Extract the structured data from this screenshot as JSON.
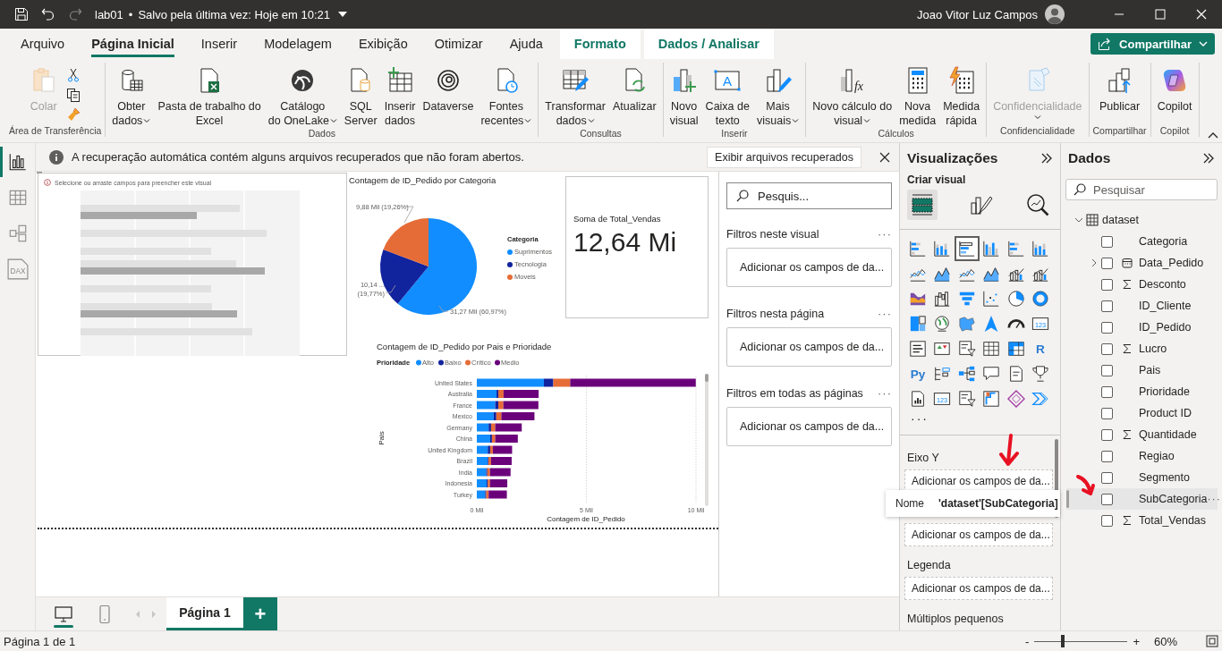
{
  "title_bar": {
    "file_name": "lab01",
    "separator": "•",
    "save_status": "Salvo pela última vez: Hoje em 10:21",
    "user_name": "Joao Vitor Luz Campos"
  },
  "ribbon_tabs": [
    {
      "label": "Arquivo",
      "selected": false,
      "kind": "normal"
    },
    {
      "label": "Página Inicial",
      "selected": true,
      "kind": "normal"
    },
    {
      "label": "Inserir",
      "selected": false,
      "kind": "normal"
    },
    {
      "label": "Modelagem",
      "selected": false,
      "kind": "normal"
    },
    {
      "label": "Exibição",
      "selected": false,
      "kind": "normal"
    },
    {
      "label": "Otimizar",
      "selected": false,
      "kind": "normal"
    },
    {
      "label": "Ajuda",
      "selected": false,
      "kind": "normal"
    },
    {
      "label": "Formato",
      "selected": false,
      "kind": "contextual"
    },
    {
      "label": "Dados / Analisar",
      "selected": false,
      "kind": "contextual"
    }
  ],
  "share_button": {
    "label": "Compartilhar"
  },
  "ribbon_groups": [
    {
      "label": "Área de Transferência",
      "kind": "clipboard",
      "buttons": [
        {
          "lines": [
            "Colar"
          ],
          "dropdown": false,
          "disabled": true
        }
      ]
    },
    {
      "label": "Dados",
      "kind": "standard",
      "buttons": [
        {
          "lines": [
            "Obter",
            "dados"
          ],
          "dropdown": true,
          "disabled": false
        },
        {
          "lines": [
            "Pasta de trabalho do",
            "Excel"
          ],
          "dropdown": false,
          "disabled": false
        },
        {
          "lines": [
            "Catálogo",
            "do OneLake"
          ],
          "dropdown": true,
          "disabled": false
        },
        {
          "lines": [
            "SQL",
            "Server"
          ],
          "dropdown": false,
          "disabled": false
        },
        {
          "lines": [
            "Inserir",
            "dados"
          ],
          "dropdown": false,
          "disabled": false
        },
        {
          "lines": [
            "Dataverse"
          ],
          "dropdown": false,
          "disabled": false
        },
        {
          "lines": [
            "Fontes",
            "recentes"
          ],
          "dropdown": true,
          "disabled": false
        }
      ]
    },
    {
      "label": "Consultas",
      "kind": "standard",
      "buttons": [
        {
          "lines": [
            "Transformar",
            "dados"
          ],
          "dropdown": true,
          "disabled": false
        },
        {
          "lines": [
            "Atualizar"
          ],
          "dropdown": false,
          "disabled": false
        }
      ]
    },
    {
      "label": "Inserir",
      "kind": "standard",
      "buttons": [
        {
          "lines": [
            "Novo",
            "visual"
          ],
          "dropdown": false,
          "disabled": false
        },
        {
          "lines": [
            "Caixa de",
            "texto"
          ],
          "glyph": "A",
          "dropdown": false,
          "disabled": false
        },
        {
          "lines": [
            "Mais",
            "visuais"
          ],
          "dropdown": true,
          "disabled": false
        }
      ]
    },
    {
      "label": "Cálculos",
      "kind": "standard",
      "buttons": [
        {
          "lines": [
            "Novo cálculo do",
            "visual"
          ],
          "dropdown": true,
          "glyph": "fx",
          "disabled": false
        },
        {
          "lines": [
            "Nova",
            "medida"
          ],
          "dropdown": false,
          "disabled": false
        },
        {
          "lines": [
            "Medida",
            "rápida"
          ],
          "dropdown": false,
          "disabled": false
        }
      ]
    },
    {
      "label": "Confidencialidade",
      "kind": "standard",
      "buttons": [
        {
          "lines": [
            "Confidencialidade"
          ],
          "dropdown": true,
          "disabled": true
        }
      ]
    },
    {
      "label": "Compartilhar",
      "kind": "standard",
      "buttons": [
        {
          "lines": [
            "Publicar"
          ],
          "dropdown": false,
          "disabled": false
        }
      ]
    },
    {
      "label": "Copilot",
      "kind": "standard",
      "buttons": [
        {
          "lines": [
            "Copilot"
          ],
          "dropdown": false,
          "disabled": false
        }
      ]
    }
  ],
  "left_nav": [
    {
      "selected": true
    },
    {
      "selected": false
    },
    {
      "selected": false
    },
    {
      "selected": false,
      "glyph": "DAX"
    }
  ],
  "recovery_bar": {
    "message": "A recuperação automática contém alguns arquivos recuperados que não foram abertos.",
    "button": "Exibir arquivos recuperados"
  },
  "report": {
    "placeholder_visual": {
      "hint": "Selecione ou arraste campos para preencher este visual"
    },
    "pie_visual": {
      "title": "Contagem de ID_Pedido por Categoria",
      "legend_title": "Categoria",
      "legend": [
        {
          "color": "#118dff"
        },
        {
          "color": "#12239e"
        },
        {
          "color": "#e66c37"
        }
      ],
      "chart_data": {
        "type": "pie",
        "legend": "right",
        "categories": [
          "Suprimentos",
          "Tecnologia",
          "Moveis"
        ],
        "values": [
          31.27,
          10.14,
          9.88
        ],
        "value_labels": [
          "31,27 Mil (60,97%)",
          "10,14 ... (19,77%)",
          "9,88 Mil (19,26%)"
        ]
      }
    },
    "card_visual": {
      "label": "Soma de Total_Vendas",
      "value": "12,64 Mi"
    },
    "bar_visual": {
      "title": "Contagem de ID_Pedido por Pais e Prioridade",
      "legend_title": "Prioridade",
      "chart_data": {
        "type": "bar",
        "orientation": "horizontal",
        "stacked": true,
        "legend": "top",
        "xlabel": "Contagem de ID_Pedido",
        "ylabel": "Pais",
        "categories": [
          "United States",
          "Australia",
          "France",
          "Mexico",
          "Germany",
          "China",
          "United Kingdom",
          "Brazil",
          "India",
          "Indonesia",
          "Turkey"
        ],
        "series": [
          {
            "name": "Alto",
            "color": "#118dff",
            "values": [
              3.06,
              0.9,
              0.84,
              0.77,
              0.54,
              0.61,
              0.5,
              0.5,
              0.43,
              0.45,
              0.38
            ]
          },
          {
            "name": "Baixo",
            "color": "#12239e",
            "values": [
              0.43,
              0.08,
              0.14,
              0.12,
              0.11,
              0.08,
              0.11,
              0.03,
              0.05,
              0.05,
              0.05
            ]
          },
          {
            "name": "Crítico",
            "color": "#e66c37",
            "values": [
              0.77,
              0.24,
              0.23,
              0.23,
              0.19,
              0.15,
              0.12,
              0.12,
              0.12,
              0.1,
              0.11
            ]
          },
          {
            "name": "Medio",
            "color": "#6b007b",
            "values": [
              5.73,
              1.6,
              1.6,
              1.51,
              1.21,
              1.03,
              0.88,
              0.94,
              0.94,
              0.79,
              0.83
            ]
          }
        ],
        "xlim": [
          0,
          10
        ],
        "xticks": [
          {
            "value": 0,
            "label": "0 Mil"
          },
          {
            "value": 5,
            "label": "5 Mil"
          },
          {
            "value": 10,
            "label": "10 Mil"
          }
        ]
      }
    }
  },
  "filters": {
    "search_placeholder": "Pesquis...",
    "sections": [
      {
        "heading": "Filtros neste visual",
        "more": "···",
        "drop_hint": "Adicionar os campos de da..."
      },
      {
        "heading": "Filtros nesta página",
        "more": "···",
        "drop_hint": "Adicionar os campos de da..."
      },
      {
        "heading": "Filtros em todas as páginas",
        "more": "···",
        "drop_hint": "Adicionar os campos de da..."
      }
    ]
  },
  "visualizations": {
    "title": "Visualizações",
    "subtitle": "Criar visual",
    "modes": [
      {
        "selected": true
      },
      {
        "selected": false
      },
      {
        "selected": false
      }
    ],
    "visual_types": [
      {
        "selected": false
      },
      {
        "selected": false
      },
      {
        "selected": true
      },
      {
        "selected": false
      },
      {
        "selected": false
      },
      {
        "selected": false
      },
      {
        "selected": false
      },
      {
        "selected": false
      },
      {
        "selected": false
      },
      {
        "selected": false
      },
      {
        "selected": false
      },
      {
        "selected": false
      },
      {
        "selected": false
      },
      {
        "selected": false
      },
      {
        "selected": false
      },
      {
        "selected": false
      },
      {
        "selected": false
      },
      {
        "selected": false
      },
      {
        "selected": false
      },
      {
        "selected": false
      },
      {
        "selected": false
      },
      {
        "selected": false
      },
      {
        "selected": false
      },
      {
        "selected": false,
        "glyph": "123"
      },
      {
        "selected": false
      },
      {
        "selected": false
      },
      {
        "selected": false
      },
      {
        "selected": false
      },
      {
        "selected": false
      },
      {
        "selected": false,
        "glyph": "R"
      },
      {
        "selected": false,
        "glyph": "Py"
      },
      {
        "selected": false
      },
      {
        "selected": false
      },
      {
        "selected": false
      },
      {
        "selected": false
      },
      {
        "selected": false
      },
      {
        "selected": false
      },
      {
        "selected": false,
        "glyph": "123"
      },
      {
        "selected": false
      },
      {
        "selected": false
      },
      {
        "selected": false
      },
      {
        "selected": false
      }
    ],
    "more": "···",
    "wells": [
      {
        "label": "Eixo Y",
        "hint": "Adicionar os campos de da..."
      },
      {
        "hint": "Adicionar os campos de da..."
      },
      {
        "label": "Legenda",
        "hint": "Adicionar os campos de da..."
      },
      {
        "label": "Múltiplos pequenos"
      }
    ]
  },
  "tooltip": {
    "key": "Nome",
    "value": "'dataset'[SubCategoria]"
  },
  "data_pane": {
    "title": "Dados",
    "search_placeholder": "Pesquisar",
    "tables": [
      {
        "label": "dataset",
        "expanded": true,
        "fields": [
          {
            "label": "Categoria",
            "kind": "text",
            "checked": false,
            "highlighted": false
          },
          {
            "label": "Data_Pedido",
            "kind": "date",
            "checked": false,
            "highlighted": false
          },
          {
            "label": "Desconto",
            "kind": "measure",
            "checked": false,
            "highlighted": false
          },
          {
            "label": "ID_Cliente",
            "kind": "text",
            "checked": false,
            "highlighted": false
          },
          {
            "label": "ID_Pedido",
            "kind": "text",
            "checked": false,
            "highlighted": false
          },
          {
            "label": "Lucro",
            "kind": "measure",
            "checked": false,
            "highlighted": false
          },
          {
            "label": "Pais",
            "kind": "text",
            "checked": false,
            "highlighted": false
          },
          {
            "label": "Prioridade",
            "kind": "text",
            "checked": false,
            "highlighted": false
          },
          {
            "label": "Product ID",
            "kind": "text",
            "checked": false,
            "highlighted": false
          },
          {
            "label": "Quantidade",
            "kind": "measure",
            "checked": false,
            "highlighted": false
          },
          {
            "label": "Regiao",
            "kind": "text",
            "checked": false,
            "highlighted": false
          },
          {
            "label": "Segmento",
            "kind": "text",
            "checked": false,
            "highlighted": false
          },
          {
            "label": "SubCategoria",
            "kind": "text",
            "checked": false,
            "highlighted": true,
            "more": "···"
          },
          {
            "label": "Total_Vendas",
            "kind": "measure",
            "checked": false,
            "highlighted": false
          }
        ]
      }
    ]
  },
  "page_bar": {
    "views": [
      {
        "selected": true
      },
      {
        "selected": false
      }
    ],
    "pages": [
      {
        "label": "Página 1",
        "selected": true
      }
    ],
    "add_button": "+"
  },
  "status_bar": {
    "page_info": "Página 1 de 1",
    "zoom": {
      "minus": "-",
      "plus": "+",
      "level": 0.3,
      "reading": "60%"
    }
  }
}
